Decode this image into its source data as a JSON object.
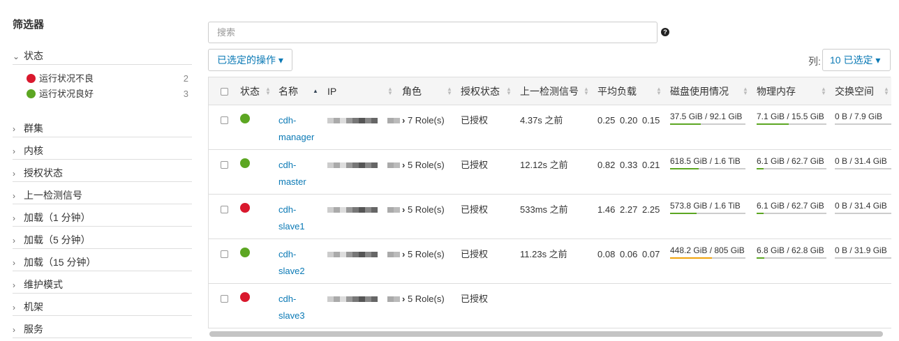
{
  "sidebar": {
    "title": "筛选器",
    "status_group": "状态",
    "status_items": [
      {
        "label": "运行状况不良",
        "count": "2",
        "color": "#d9182d"
      },
      {
        "label": "运行状况良好",
        "count": "3",
        "color": "#5ca622"
      }
    ],
    "groups": [
      "群集",
      "内核",
      "授权状态",
      "上一检测信号",
      "加载（1 分钟）",
      "加载（5 分钟）",
      "加载（15 分钟）",
      "维护模式",
      "机架",
      "服务"
    ]
  },
  "search": {
    "placeholder": "搜索",
    "help": "?"
  },
  "toolbar": {
    "actions_label": "已选定的操作 ▾",
    "columns_label": "列:",
    "columns_value": "10 已选定 ▾"
  },
  "table": {
    "headers": [
      "状态",
      "名称",
      "IP",
      "角色",
      "授权状态",
      "上一检测信号",
      "平均负载",
      "磁盘使用情况",
      "物理内存",
      "交换空间"
    ],
    "rows": [
      {
        "status": "good",
        "name1": "cdh-",
        "name2": "manager",
        "roles": "7 Role(s)",
        "auth": "已授权",
        "heartbeat": "4.37s 之前",
        "load": [
          "0.25",
          "0.20",
          "0.15"
        ],
        "disk": {
          "text": "37.5 GiB / 92.1 GiB",
          "frac": 0.41,
          "color": "#5ca622"
        },
        "mem": {
          "text": "7.1 GiB / 15.5 GiB",
          "frac": 0.46,
          "color": "#5ca622"
        },
        "swap": {
          "text": "0 B / 7.9 GiB",
          "frac": 0
        }
      },
      {
        "status": "good",
        "name1": "cdh-",
        "name2": "master",
        "roles": "5 Role(s)",
        "auth": "已授权",
        "heartbeat": "12.12s 之前",
        "load": [
          "0.82",
          "0.33",
          "0.21"
        ],
        "disk": {
          "text": "618.5 GiB / 1.6 TiB",
          "frac": 0.38,
          "color": "#5ca622"
        },
        "mem": {
          "text": "6.1 GiB / 62.7 GiB",
          "frac": 0.1,
          "color": "#5ca622"
        },
        "swap": {
          "text": "0 B / 31.4 GiB",
          "frac": 0
        }
      },
      {
        "status": "bad",
        "name1": "cdh-",
        "name2": "slave1",
        "roles": "5 Role(s)",
        "auth": "已授权",
        "heartbeat": "533ms 之前",
        "load": [
          "1.46",
          "2.27",
          "2.25"
        ],
        "disk": {
          "text": "573.8 GiB / 1.6 TiB",
          "frac": 0.35,
          "color": "#5ca622"
        },
        "mem": {
          "text": "6.1 GiB / 62.7 GiB",
          "frac": 0.1,
          "color": "#5ca622"
        },
        "swap": {
          "text": "0 B / 31.4 GiB",
          "frac": 0
        }
      },
      {
        "status": "good",
        "name1": "cdh-",
        "name2": "slave2",
        "roles": "5 Role(s)",
        "auth": "已授权",
        "heartbeat": "11.23s 之前",
        "load": [
          "0.08",
          "0.06",
          "0.07"
        ],
        "disk": {
          "text": "448.2 GiB / 805 GiB",
          "frac": 0.56,
          "color": "#f0a30a"
        },
        "mem": {
          "text": "6.8 GiB / 62.8 GiB",
          "frac": 0.11,
          "color": "#5ca622"
        },
        "swap": {
          "text": "0 B / 31.9 GiB",
          "frac": 0
        }
      },
      {
        "status": "bad",
        "name1": "cdh-",
        "name2": "slave3",
        "roles": "5 Role(s)",
        "auth": "已授权"
      }
    ]
  },
  "colors": {
    "good": "#5ca622",
    "bad": "#d9182d",
    "link": "#0a79b5"
  }
}
